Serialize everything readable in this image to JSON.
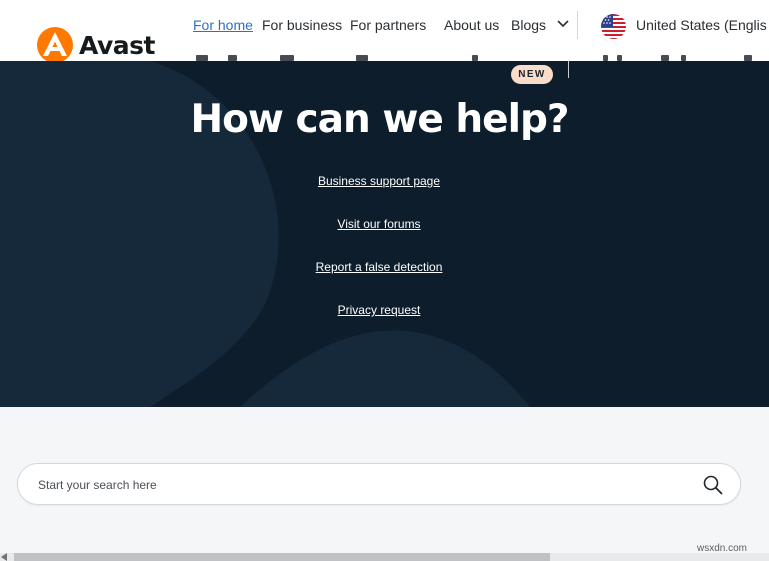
{
  "brand": {
    "name": "Avast",
    "logo_color": "#ff7800"
  },
  "nav": {
    "items": [
      {
        "label": "For home",
        "active": true
      },
      {
        "label": "For business",
        "active": false
      },
      {
        "label": "For partners",
        "active": false
      },
      {
        "label": "About us",
        "active": false
      },
      {
        "label": "Blogs",
        "active": false
      }
    ],
    "dropdown_icon": "chevron-down-icon",
    "locale": {
      "label": "United States (Englis",
      "flag_icon": "us-flag-icon"
    }
  },
  "hero": {
    "badge": "NEW",
    "title": "How can we help?",
    "links": [
      "Business support page",
      "Visit our forums",
      "Report a false detection",
      "Privacy request"
    ],
    "background_color": "#0d1d2b"
  },
  "search": {
    "placeholder": "Start your search here",
    "value": "",
    "icon": "search-icon"
  },
  "watermark": "wsxdn.com"
}
